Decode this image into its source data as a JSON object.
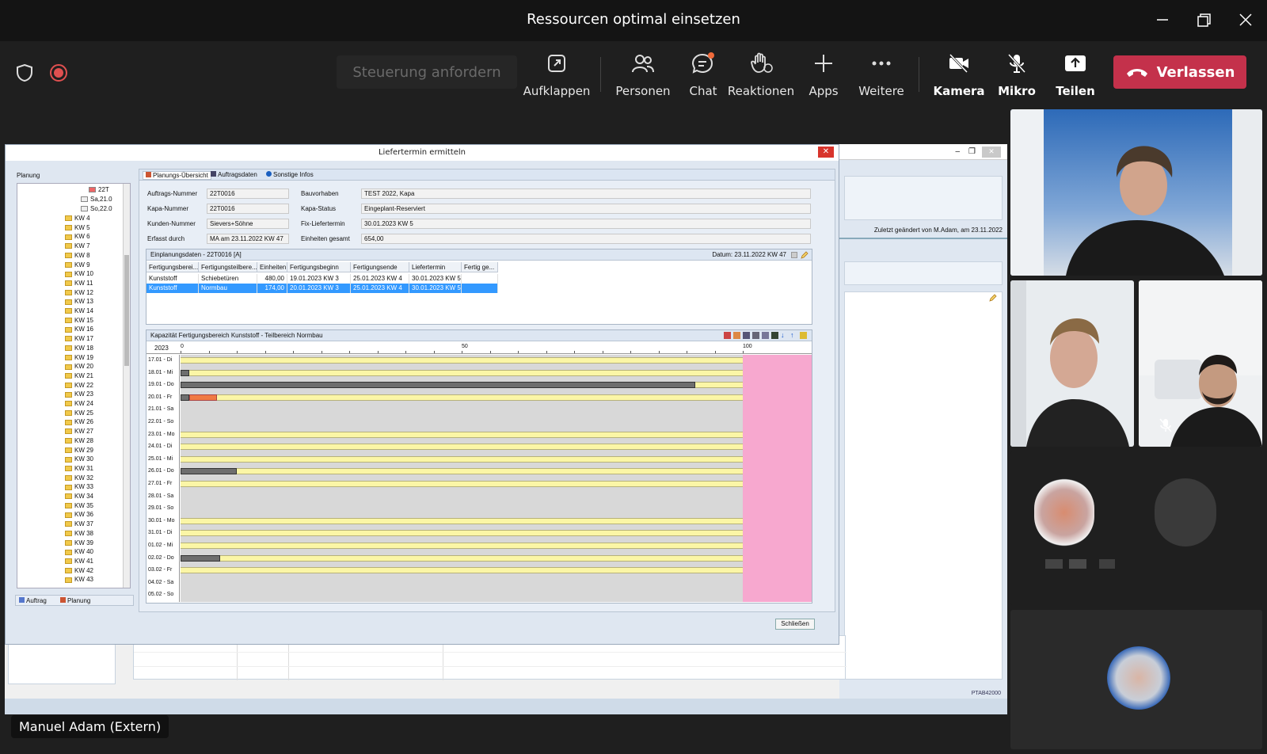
{
  "window": {
    "title": "Ressourcen optimal einsetzen"
  },
  "toolbar": {
    "request_control": "Steuerung anfordern",
    "popout": "Aufklappen",
    "people": "Personen",
    "chat": "Chat",
    "reactions": "Reaktionen",
    "apps": "Apps",
    "more": "Weitere",
    "camera": "Kamera",
    "mic": "Mikro",
    "share": "Teilen",
    "leave": "Verlassen"
  },
  "presenter_name": "Manuel Adam (Extern)",
  "app": {
    "dialog_title": "Liefertermin ermitteln",
    "close_button": "Schließen",
    "bg_changed": "Zuletzt geändert von M.Adam, am 23.11.2022",
    "bg_status": "PTAB42000",
    "tree": {
      "header": "Planung",
      "top_items": [
        "22T",
        "Sa,21.0",
        "So,22.0"
      ],
      "weeks": [
        "KW 4",
        "KW 5",
        "KW 6",
        "KW 7",
        "KW 8",
        "KW 9",
        "KW 10",
        "KW 11",
        "KW 12",
        "KW 13",
        "KW 14",
        "KW 15",
        "KW 16",
        "KW 17",
        "KW 18",
        "KW 19",
        "KW 20",
        "KW 21",
        "KW 22",
        "KW 23",
        "KW 24",
        "KW 25",
        "KW 26",
        "KW 27",
        "KW 28",
        "KW 29",
        "KW 30",
        "KW 31",
        "KW 32",
        "KW 33",
        "KW 34",
        "KW 35",
        "KW 36",
        "KW 37",
        "KW 38",
        "KW 39",
        "KW 40",
        "KW 41",
        "KW 42",
        "KW 43"
      ],
      "tabs": [
        "Auftrag",
        "Planung"
      ]
    },
    "tabs": [
      "Planungs-Übersicht",
      "Auftragsdaten",
      "Sonstige Infos"
    ],
    "form": {
      "auftrag_label": "Auftrags-Nummer",
      "auftrag_value": "22T0016",
      "kapa_label": "Kapa-Nummer",
      "kapa_value": "22T0016",
      "kunde_label": "Kunden-Nummer",
      "kunde_value": "Sievers+Söhne",
      "erfasst_label": "Erfasst durch",
      "erfasst_value": "MA am 23.11.2022 KW 47",
      "bau_label": "Bauvorhaben",
      "bau_value": "TEST 2022, Kapa",
      "status_label": "Kapa-Status",
      "status_value": "Eingeplant-Reserviert",
      "fix_label": "Fix-Liefertermin",
      "fix_value": "30.01.2023 KW 5",
      "einheiten_label": "Einheiten gesamt",
      "einheiten_value": "654,00"
    },
    "einplanung": {
      "title": "Einplanungsdaten - 22T0016 [A]",
      "datum": "Datum: 23.11.2022 KW 47",
      "columns": [
        "Fertigungsberei...",
        "Fertigungsteilbere...",
        "Einheiten",
        "Fertigungsbeginn",
        "Fertigungsende",
        "Liefertermin",
        "Fertig ge..."
      ],
      "rows": [
        [
          "Kunststoff",
          "Schiebetüren",
          "480,00",
          "19.01.2023 KW 3",
          "25.01.2023 KW 4",
          "30.01.2023 KW 5",
          ""
        ],
        [
          "Kunststoff",
          "Normbau",
          "174,00",
          "20.01.2023 KW 3",
          "25.01.2023 KW 4",
          "30.01.2023 KW 5",
          ""
        ]
      ]
    },
    "capacity": {
      "title": "Kapazität Fertigungsbereich Kunststoff - Teilbereich Normbau",
      "year": "2023",
      "scale": [
        "0",
        "50",
        "100"
      ],
      "days": [
        {
          "label": "17.01 - Di",
          "bar": "yellow",
          "used": 0,
          "extra": 0
        },
        {
          "label": "18.01 - Mi",
          "bar": "yellow",
          "used": 1.5,
          "extra": 0
        },
        {
          "label": "19.01 - Do",
          "bar": "yellow",
          "used": 91.5,
          "extra": 0
        },
        {
          "label": "20.01 - Fr",
          "bar": "yellow",
          "used": 1.5,
          "extra": 5
        },
        {
          "label": "21.01 - Sa",
          "bar": "none",
          "used": 0,
          "extra": 0
        },
        {
          "label": "22.01 - So",
          "bar": "none",
          "used": 0,
          "extra": 0
        },
        {
          "label": "23.01 - Mo",
          "bar": "yellow",
          "used": 0,
          "extra": 0
        },
        {
          "label": "24.01 - Di",
          "bar": "yellow",
          "used": 0,
          "extra": 0
        },
        {
          "label": "25.01 - Mi",
          "bar": "yellow",
          "used": 0,
          "extra": 0
        },
        {
          "label": "26.01 - Do",
          "bar": "yellow",
          "used": 10,
          "extra": 0
        },
        {
          "label": "27.01 - Fr",
          "bar": "yellow",
          "used": 0,
          "extra": 0
        },
        {
          "label": "28.01 - Sa",
          "bar": "none",
          "used": 0,
          "extra": 0
        },
        {
          "label": "29.01 - So",
          "bar": "none",
          "used": 0,
          "extra": 0
        },
        {
          "label": "30.01 - Mo",
          "bar": "yellow",
          "used": 0,
          "extra": 0
        },
        {
          "label": "31.01 - Di",
          "bar": "yellow",
          "used": 0,
          "extra": 0
        },
        {
          "label": "01.02 - Mi",
          "bar": "yellow",
          "used": 0,
          "extra": 0
        },
        {
          "label": "02.02 - Do",
          "bar": "yellow",
          "used": 7,
          "extra": 0
        },
        {
          "label": "03.02 - Fr",
          "bar": "yellow",
          "used": 0,
          "extra": 0
        },
        {
          "label": "04.02 - Sa",
          "bar": "none",
          "used": 0,
          "extra": 0
        },
        {
          "label": "05.02 - So",
          "bar": "none",
          "used": 0,
          "extra": 0
        }
      ]
    }
  }
}
